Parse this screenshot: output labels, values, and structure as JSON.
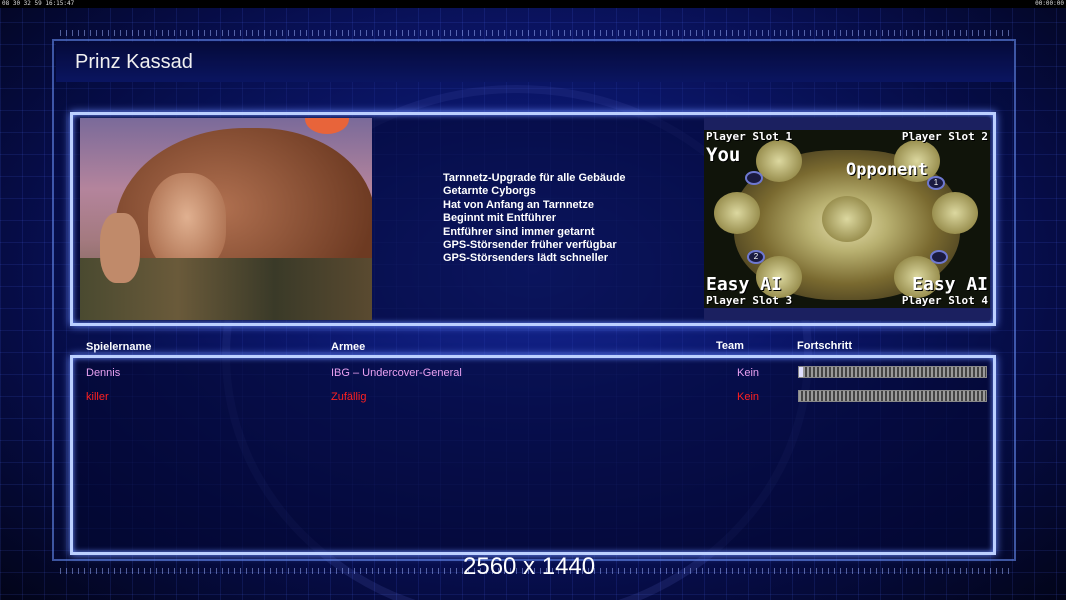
{
  "status_bar": {
    "left_text": "08 30 32 59 16:15:47",
    "right_text": "00:00:00"
  },
  "general": {
    "name": "Prinz Kassad",
    "perks": [
      "Tarnnetz-Upgrade für alle Gebäude",
      "Getarnte Cyborgs",
      "Hat von Anfang an Tarnnetze",
      "Beginnt mit Entführer",
      "Entführer sind immer getarnt",
      "GPS-Störsender früher verfügbar",
      "GPS-Störsenders lädt schneller"
    ]
  },
  "map": {
    "slot1": "Player Slot 1",
    "slot2": "Player Slot 2",
    "slot3": "Player Slot 3",
    "slot4": "Player Slot 4",
    "you_label": "You",
    "opponent_label": "Opponent",
    "easy_ai_left": "Easy AI",
    "easy_ai_right": "Easy AI",
    "start_1": "1",
    "start_2": "2"
  },
  "table": {
    "headers": {
      "player": "Spielername",
      "army": "Armee",
      "team": "Team",
      "progress": "Fortschritt"
    },
    "rows": [
      {
        "player": "Dennis",
        "army": "IBG – Undercover-General",
        "team": "Kein",
        "progress": 0.02,
        "color": "#e8a0f0"
      },
      {
        "player": "killer",
        "army": "Zufällig",
        "team": "Kein",
        "progress": 0.0,
        "color": "#ff2020"
      }
    ]
  },
  "resolution_label": "2560 x 1440",
  "colors": {
    "panel_border": "#bcd0ff",
    "accent": "#6b8cff"
  }
}
